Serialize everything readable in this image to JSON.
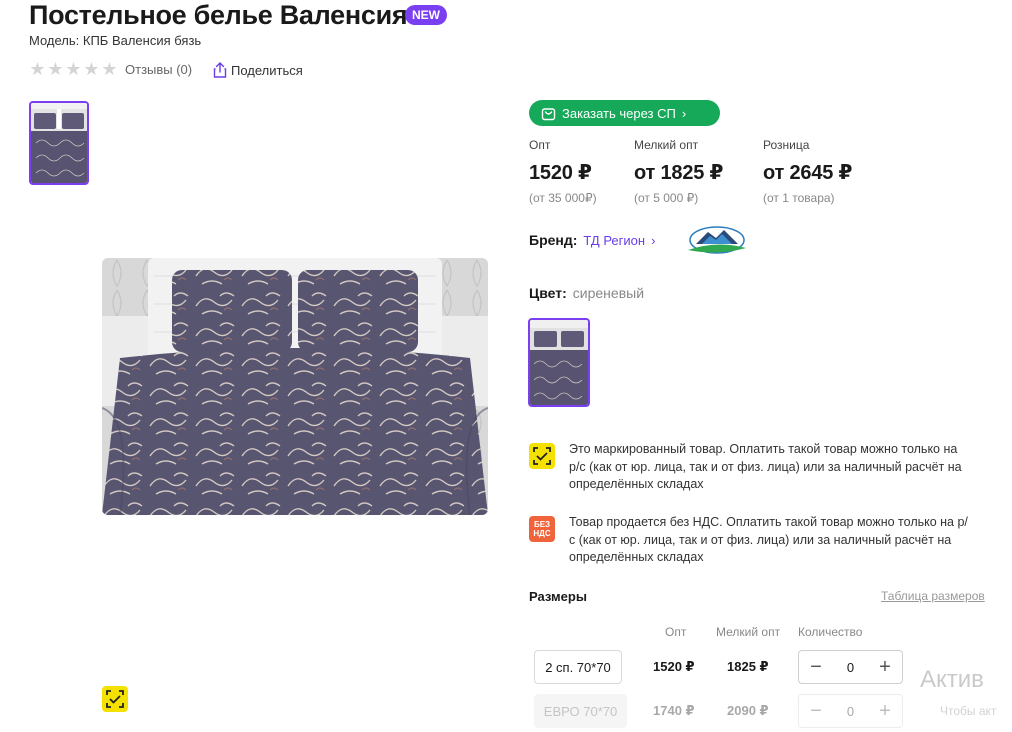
{
  "product": {
    "title": "Постельное белье Валенсия",
    "badge": "NEW",
    "model": "Модель: КПБ Валенсия бязь",
    "rating_stars": 0,
    "reviews": "Отзывы (0)",
    "share": "Поделиться"
  },
  "order_button": {
    "label": "Заказать через СП"
  },
  "prices": [
    {
      "label": "Опт",
      "value": "1520 ₽",
      "note": "(от 35 000₽)"
    },
    {
      "label": "Мелкий опт",
      "value": "от 1825 ₽",
      "note": "(от 5 000 ₽)"
    },
    {
      "label": "Розница",
      "value": "от 2645 ₽",
      "note": "(от 1 товара)"
    }
  ],
  "brand": {
    "label": "Бренд:",
    "value": "ТД Регион"
  },
  "color": {
    "label": "Цвет:",
    "value": "сиреневый"
  },
  "notices": [
    {
      "icon": "marking-icon",
      "text": "Это маркированный товар. Оплатить такой товар можно только на р/с (как от юр. лица, так и от физ. лица) или за наличный расчёт на определённых складах"
    },
    {
      "icon": "no-vat-icon",
      "icon_text": "БЕЗ НДС",
      "text": "Товар продается без НДС. Оплатить такой товар можно только на р/с (как от юр. лица, так и от физ. лица) или за наличный расчёт на определённых складах"
    }
  ],
  "sizes": {
    "title": "Размеры",
    "table_link": "Таблица размеров",
    "headers": {
      "opt": "Опт",
      "small_opt": "Мелкий опт",
      "qty": "Количество"
    },
    "rows": [
      {
        "size": "2 сп. 70*70",
        "opt": "1520 ₽",
        "small_opt": "1825 ₽",
        "qty": "0",
        "available": true
      },
      {
        "size": "ЕВРО 70*70",
        "opt": "1740 ₽",
        "small_opt": "2090 ₽",
        "qty": "0",
        "available": false
      }
    ]
  },
  "watermark": {
    "line1": "Актив",
    "line2": "Чтобы акт"
  },
  "colors": {
    "accent": "#7b3ff2",
    "green": "#17a95a",
    "marking_yellow": "#f5e100",
    "no_vat_orange": "#f0643c"
  }
}
